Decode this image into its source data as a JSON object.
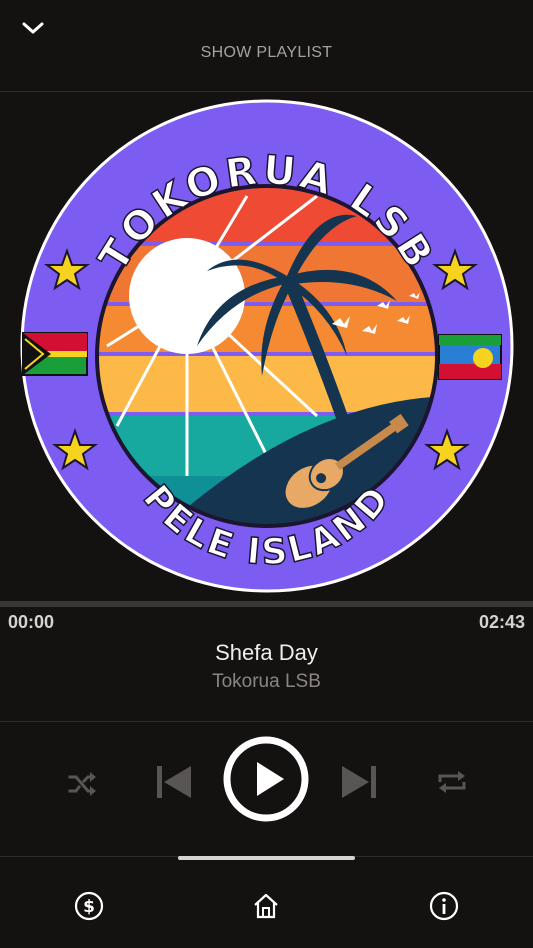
{
  "header": {
    "show_playlist_label": "SHOW PLAYLIST"
  },
  "artwork": {
    "top_text": "TOKORUA LSB",
    "bottom_text": "PELE ISLAND",
    "colors": {
      "ring": "#7d5cf2",
      "sky_red": "#ef4a33",
      "sky_orange": "#f58a32",
      "sky_yellow": "#fcb947",
      "sea": "#17a9a0",
      "hill": "#143450"
    }
  },
  "player": {
    "elapsed": "00:00",
    "duration": "02:43",
    "progress": 0,
    "title": "Shefa Day",
    "artist": "Tokorua LSB"
  },
  "controls": {
    "shuffle": "shuffle-icon",
    "previous": "skip-previous-icon",
    "play": "play-icon",
    "next": "skip-next-icon",
    "repeat": "repeat-icon"
  },
  "tabs": {
    "items": [
      "dollar-icon",
      "home-icon",
      "info-icon"
    ]
  }
}
